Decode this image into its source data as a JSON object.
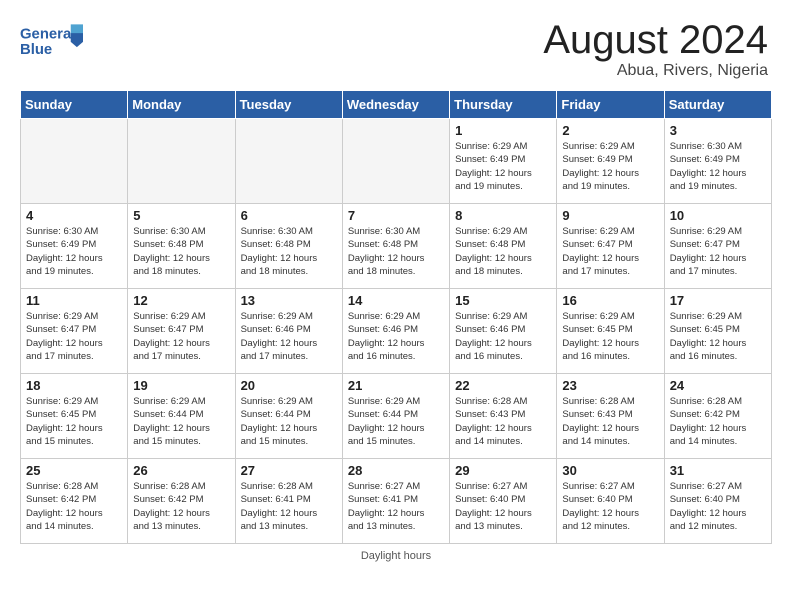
{
  "header": {
    "logo_line1": "General",
    "logo_line2": "Blue",
    "month": "August 2024",
    "location": "Abua, Rivers, Nigeria"
  },
  "days_of_week": [
    "Sunday",
    "Monday",
    "Tuesday",
    "Wednesday",
    "Thursday",
    "Friday",
    "Saturday"
  ],
  "weeks": [
    [
      {
        "day": "",
        "info": ""
      },
      {
        "day": "",
        "info": ""
      },
      {
        "day": "",
        "info": ""
      },
      {
        "day": "",
        "info": ""
      },
      {
        "day": "1",
        "info": "Sunrise: 6:29 AM\nSunset: 6:49 PM\nDaylight: 12 hours\nand 19 minutes."
      },
      {
        "day": "2",
        "info": "Sunrise: 6:29 AM\nSunset: 6:49 PM\nDaylight: 12 hours\nand 19 minutes."
      },
      {
        "day": "3",
        "info": "Sunrise: 6:30 AM\nSunset: 6:49 PM\nDaylight: 12 hours\nand 19 minutes."
      }
    ],
    [
      {
        "day": "4",
        "info": "Sunrise: 6:30 AM\nSunset: 6:49 PM\nDaylight: 12 hours\nand 19 minutes."
      },
      {
        "day": "5",
        "info": "Sunrise: 6:30 AM\nSunset: 6:48 PM\nDaylight: 12 hours\nand 18 minutes."
      },
      {
        "day": "6",
        "info": "Sunrise: 6:30 AM\nSunset: 6:48 PM\nDaylight: 12 hours\nand 18 minutes."
      },
      {
        "day": "7",
        "info": "Sunrise: 6:30 AM\nSunset: 6:48 PM\nDaylight: 12 hours\nand 18 minutes."
      },
      {
        "day": "8",
        "info": "Sunrise: 6:29 AM\nSunset: 6:48 PM\nDaylight: 12 hours\nand 18 minutes."
      },
      {
        "day": "9",
        "info": "Sunrise: 6:29 AM\nSunset: 6:47 PM\nDaylight: 12 hours\nand 17 minutes."
      },
      {
        "day": "10",
        "info": "Sunrise: 6:29 AM\nSunset: 6:47 PM\nDaylight: 12 hours\nand 17 minutes."
      }
    ],
    [
      {
        "day": "11",
        "info": "Sunrise: 6:29 AM\nSunset: 6:47 PM\nDaylight: 12 hours\nand 17 minutes."
      },
      {
        "day": "12",
        "info": "Sunrise: 6:29 AM\nSunset: 6:47 PM\nDaylight: 12 hours\nand 17 minutes."
      },
      {
        "day": "13",
        "info": "Sunrise: 6:29 AM\nSunset: 6:46 PM\nDaylight: 12 hours\nand 17 minutes."
      },
      {
        "day": "14",
        "info": "Sunrise: 6:29 AM\nSunset: 6:46 PM\nDaylight: 12 hours\nand 16 minutes."
      },
      {
        "day": "15",
        "info": "Sunrise: 6:29 AM\nSunset: 6:46 PM\nDaylight: 12 hours\nand 16 minutes."
      },
      {
        "day": "16",
        "info": "Sunrise: 6:29 AM\nSunset: 6:45 PM\nDaylight: 12 hours\nand 16 minutes."
      },
      {
        "day": "17",
        "info": "Sunrise: 6:29 AM\nSunset: 6:45 PM\nDaylight: 12 hours\nand 16 minutes."
      }
    ],
    [
      {
        "day": "18",
        "info": "Sunrise: 6:29 AM\nSunset: 6:45 PM\nDaylight: 12 hours\nand 15 minutes."
      },
      {
        "day": "19",
        "info": "Sunrise: 6:29 AM\nSunset: 6:44 PM\nDaylight: 12 hours\nand 15 minutes."
      },
      {
        "day": "20",
        "info": "Sunrise: 6:29 AM\nSunset: 6:44 PM\nDaylight: 12 hours\nand 15 minutes."
      },
      {
        "day": "21",
        "info": "Sunrise: 6:29 AM\nSunset: 6:44 PM\nDaylight: 12 hours\nand 15 minutes."
      },
      {
        "day": "22",
        "info": "Sunrise: 6:28 AM\nSunset: 6:43 PM\nDaylight: 12 hours\nand 14 minutes."
      },
      {
        "day": "23",
        "info": "Sunrise: 6:28 AM\nSunset: 6:43 PM\nDaylight: 12 hours\nand 14 minutes."
      },
      {
        "day": "24",
        "info": "Sunrise: 6:28 AM\nSunset: 6:42 PM\nDaylight: 12 hours\nand 14 minutes."
      }
    ],
    [
      {
        "day": "25",
        "info": "Sunrise: 6:28 AM\nSunset: 6:42 PM\nDaylight: 12 hours\nand 14 minutes."
      },
      {
        "day": "26",
        "info": "Sunrise: 6:28 AM\nSunset: 6:42 PM\nDaylight: 12 hours\nand 13 minutes."
      },
      {
        "day": "27",
        "info": "Sunrise: 6:28 AM\nSunset: 6:41 PM\nDaylight: 12 hours\nand 13 minutes."
      },
      {
        "day": "28",
        "info": "Sunrise: 6:27 AM\nSunset: 6:41 PM\nDaylight: 12 hours\nand 13 minutes."
      },
      {
        "day": "29",
        "info": "Sunrise: 6:27 AM\nSunset: 6:40 PM\nDaylight: 12 hours\nand 13 minutes."
      },
      {
        "day": "30",
        "info": "Sunrise: 6:27 AM\nSunset: 6:40 PM\nDaylight: 12 hours\nand 12 minutes."
      },
      {
        "day": "31",
        "info": "Sunrise: 6:27 AM\nSunset: 6:40 PM\nDaylight: 12 hours\nand 12 minutes."
      }
    ]
  ],
  "footer": {
    "daylight_label": "Daylight hours"
  }
}
